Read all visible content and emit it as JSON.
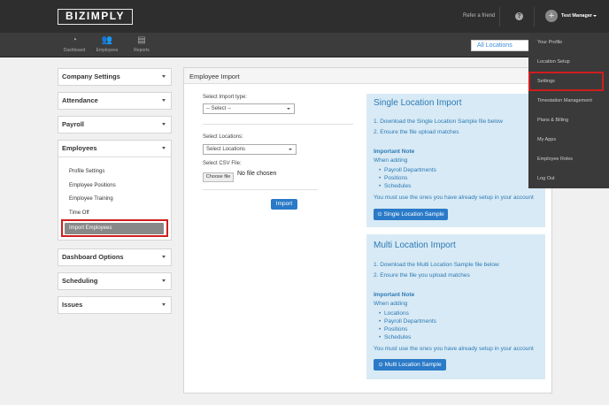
{
  "topbar": {
    "logo": "BIZIMPLY",
    "refer": "Refer a friend",
    "help": "?",
    "avatar_glyph": "+",
    "user": "Test Manager"
  },
  "nav": [
    {
      "label": "Dashboard",
      "icon": "dashboard-icon",
      "glyph": "◔"
    },
    {
      "label": "Employees",
      "icon": "employees-icon",
      "glyph": "👥"
    },
    {
      "label": "Reports",
      "icon": "reports-icon",
      "glyph": "▤"
    }
  ],
  "location_select": "All Locations",
  "sidebar": {
    "company_settings": "Company Settings",
    "attendance": "Attendance",
    "payroll": "Payroll",
    "employees": "Employees",
    "employee_items": [
      "Profile Settings",
      "Employee Positions",
      "Employee Training",
      "Time Off",
      "Import Employees"
    ],
    "dashboard_options": "Dashboard Options",
    "scheduling": "Scheduling",
    "issues": "Issues"
  },
  "import": {
    "title": "Employee Import",
    "type_label": "Select Import type:",
    "type_value": "-- Select --",
    "locations_label": "Select Locations:",
    "locations_value": "Select Locations",
    "csv_label": "Select CSV File:",
    "choose_file": "Choose file",
    "no_file": "No file chosen",
    "import_button": "Import"
  },
  "single": {
    "title": "Single Location Import",
    "step1": "1. Download the Single Location Sample file below",
    "step2": "2. Ensure the file upload matches",
    "important": "Important Note",
    "when": "When adding",
    "bullets": [
      "Payroll Departments",
      "Positions",
      "Schedules"
    ],
    "must": "You must use the ones you have already setup in your account",
    "button": "⊙ Single Location Sample"
  },
  "multi": {
    "title": "Multi Location Import",
    "step1": "1. Download the Multi Location Sample file below",
    "step2": "2. Ensure the file you upload matches",
    "important": "Important Note",
    "when": "When adding",
    "bullets": [
      "Locations",
      "Payroll Departments",
      "Positions",
      "Schedules"
    ],
    "must": "You must use the ones you have already setup in your account",
    "button": "⊙ Multi Location Sample"
  },
  "dropdown": [
    "Your Profile",
    "Location Setup",
    "Settings",
    "Timestation Management",
    "Plans & Billing",
    "My Apps",
    "Employee Roles",
    "Log Out"
  ]
}
